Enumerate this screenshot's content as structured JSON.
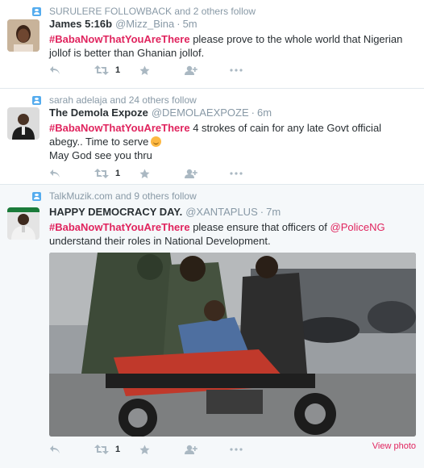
{
  "tweets": [
    {
      "context": "SURULERE FOLLOWBACK and 2 others follow",
      "fullname": "James 5:16b",
      "username": "@Mizz_Bina",
      "time": "5m",
      "hashtag": "#BabaNowThatYouAreThere",
      "text_after": " please prove to the whole world that Nigerian jollof is better than Ghanian jollof.",
      "retweets": "1"
    },
    {
      "context": "sarah adelaja and 24 others follow",
      "fullname": "The Demola Expoze",
      "username": "@DEMOLAEXPOZE",
      "time": "6m",
      "hashtag": "#BabaNowThatYouAreThere",
      "text_after": " 4 strokes of cain for any late Govt official abegy.. Time to serve",
      "text_line2": "May God see you thru",
      "retweets": "1"
    },
    {
      "context": "TalkMuzik.com and 9 others follow",
      "fullname": "HAPPY DEMOCRACY DAY.",
      "username": "@XANTAPLUS",
      "time": "7m",
      "hashtag": "#BabaNowThatYouAreThere",
      "text_mid": " please ensure that officers of ",
      "mention": "@PoliceNG",
      "text_after": " understand their roles in National Development.",
      "retweets": "1",
      "view_photo": "View photo"
    }
  ],
  "separator": "·",
  "icons": {
    "context": "follow-context-icon",
    "reply": "reply-icon",
    "retweet": "retweet-icon",
    "favorite": "star-icon",
    "follow": "follow-icon",
    "more": "more-icon"
  },
  "colors": {
    "accent": "#e0245e",
    "muted": "#8899a6",
    "icon": "#aab8c2",
    "twitter_blue": "#55acee"
  }
}
